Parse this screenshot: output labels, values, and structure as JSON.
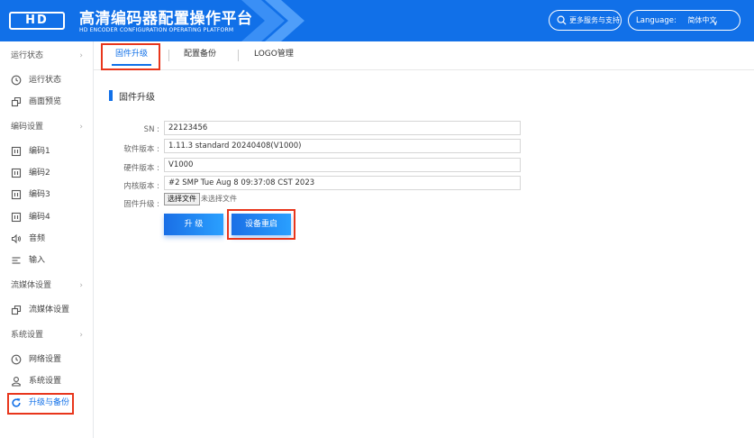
{
  "header": {
    "logo_text": "HD",
    "title": "高清编码器配置操作平台",
    "subtitle": "HD ENCODER CONFIGURATION OPERATING PLATFORM",
    "services_label": "更多服务与支持",
    "language_label": "Language:",
    "language_value": "简体中文",
    "bg_color": "#1170e8"
  },
  "sidebar": {
    "groups": {
      "status": "运行状态",
      "encode": "编码设置",
      "stream": "流媒体设置",
      "system": "系统设置"
    },
    "items": {
      "run_status": "运行状态",
      "preview": "画面预览",
      "enc1": "编码1",
      "enc2": "编码2",
      "enc3": "编码3",
      "enc4": "编码4",
      "audio": "音频",
      "input": "输入",
      "stream_settings": "流媒体设置",
      "network": "网络设置",
      "system_settings": "系统设置",
      "upgrade_backup": "升级与备份"
    },
    "chevron": "›"
  },
  "tabs": {
    "firmware": "固件升级",
    "backup": "配置备份",
    "logo": "LOGO管理"
  },
  "section": {
    "title": "固件升级"
  },
  "form": {
    "sn_label": "SN :",
    "sn_value": "22123456",
    "sw_label": "软件版本 :",
    "sw_value": "1.11.3 standard 20240408(V1000)",
    "hw_label": "硬件版本 :",
    "hw_value": "V1000",
    "kernel_label": "内核版本 :",
    "kernel_value": "#2 SMP Tue Aug 8 09:37:08 CST 2023",
    "fw_label": "固件升级 :",
    "choose_file": "选择文件",
    "no_file": "未选择文件",
    "upgrade_button": "升 级",
    "reboot_button": "设备重启"
  },
  "colors": {
    "accent": "#1170e8",
    "highlight": "#e8361c"
  }
}
